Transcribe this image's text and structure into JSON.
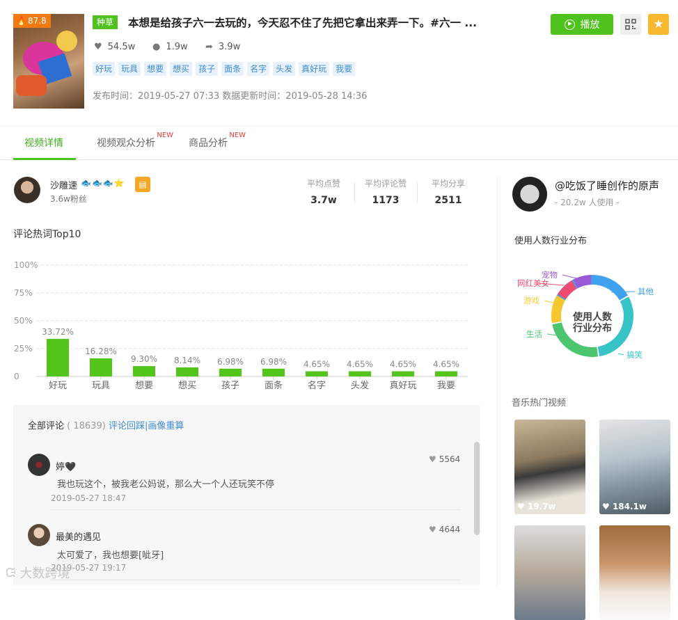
{
  "video": {
    "heat_score": "87.8",
    "category_tag": "种草",
    "title": "本想是给孩子六一去玩的，今天忍不住了先把它拿出来弄一下。#六一 ...",
    "likes": "54.5w",
    "comments": "1.9w",
    "shares": "3.9w",
    "tags": [
      "好玩",
      "玩具",
      "想要",
      "想买",
      "孩子",
      "面条",
      "名字",
      "头发",
      "真好玩",
      "我要"
    ],
    "publish_time": "发布时间：2019-05-27 07:33",
    "update_time": "数据更新时间：2019-05-28 14:36",
    "play_label": "播放"
  },
  "tabs": [
    {
      "label": "视频详情",
      "new": ""
    },
    {
      "label": "视频观众分析",
      "new": "NEW"
    },
    {
      "label": "商品分析",
      "new": "NEW"
    }
  ],
  "author": {
    "name": "沙雕速",
    "emoji": "🐟🐟🐟⭐",
    "fans": "3.6w粉丝",
    "avg": [
      {
        "label": "平均点赞",
        "value": "3.7w"
      },
      {
        "label": "平均评论赞",
        "value": "1173"
      },
      {
        "label": "平均分享",
        "value": "2511"
      }
    ]
  },
  "chart_data": {
    "type": "bar",
    "title": "评论热词Top10",
    "categories": [
      "好玩",
      "玩具",
      "想要",
      "想买",
      "孩子",
      "面条",
      "名字",
      "头发",
      "真好玩",
      "我要"
    ],
    "values": [
      33.72,
      16.28,
      9.3,
      8.14,
      6.98,
      6.98,
      4.65,
      4.65,
      4.65,
      4.65
    ],
    "value_labels": [
      "33.72%",
      "16.28%",
      "9.30%",
      "8.14%",
      "6.98%",
      "6.98%",
      "4.65%",
      "4.65%",
      "4.65%",
      "4.65%"
    ],
    "yticks": [
      "0",
      "25%",
      "50%",
      "75%",
      "100%"
    ],
    "ylim": [
      0,
      100
    ],
    "color": "#52c41a",
    "grid": true
  },
  "comments": {
    "header_label": "全部评论",
    "count": "( 18639)",
    "link": "评论回踩|画像重算",
    "items": [
      {
        "user": "婷🖤",
        "text": "我也玩这个，被我老公妈说，那么大一个人还玩笑不停",
        "time": "2019-05-27 18:47",
        "likes": "5564"
      },
      {
        "user": "最美的遇见",
        "text": "太可爱了，我也想要[呲牙]",
        "time": "2019-05-27 19:17",
        "likes": "4644"
      }
    ]
  },
  "music": {
    "title": "@吃饭了睡创作的原声",
    "users": "- 20.2w 人使用 -"
  },
  "industry": {
    "title": "使用人数行业分布",
    "center": [
      "使用人数",
      "行业分布"
    ],
    "segments": [
      {
        "name": "其他",
        "color": "#3ea2f0"
      },
      {
        "name": "搞笑",
        "color": "#36c4c7"
      },
      {
        "name": "生活",
        "color": "#4cc56f"
      },
      {
        "name": "游戏",
        "color": "#f5c832"
      },
      {
        "name": "网红美女",
        "color": "#ef4e72"
      },
      {
        "name": "宠物",
        "color": "#9b59d6"
      }
    ]
  },
  "hot_videos": {
    "title": "音乐热门视频",
    "items": [
      {
        "likes": "19.7w"
      },
      {
        "likes": "184.1w"
      },
      {
        "likes": ""
      },
      {
        "likes": ""
      }
    ]
  },
  "watermark": "大数跨境"
}
